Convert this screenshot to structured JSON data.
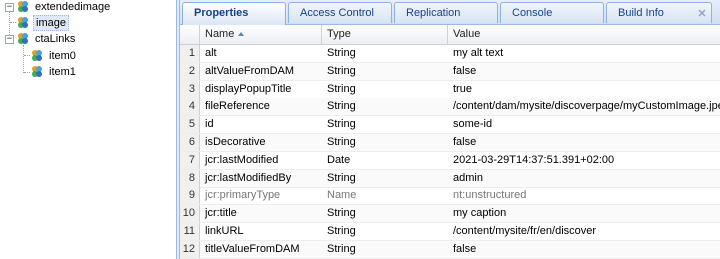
{
  "tree": {
    "nodes": [
      {
        "label": "extendedimage",
        "icon": "node-icon",
        "expanded": true,
        "level": 0,
        "selected": false
      },
      {
        "label": "image",
        "icon": "node-icon",
        "expanded": false,
        "level": 1,
        "selected": true
      },
      {
        "label": "ctaLinks",
        "icon": "node-icon",
        "expanded": true,
        "level": 1,
        "selected": false
      },
      {
        "label": "item0",
        "icon": "node-icon",
        "expanded": false,
        "level": 2,
        "selected": false
      },
      {
        "label": "item1",
        "icon": "node-icon",
        "expanded": false,
        "level": 2,
        "selected": false
      }
    ]
  },
  "tabs": [
    {
      "label": "Properties",
      "active": true
    },
    {
      "label": "Access Control",
      "active": false
    },
    {
      "label": "Replication",
      "active": false
    },
    {
      "label": "Console",
      "active": false
    },
    {
      "label": "Build Info",
      "active": false
    }
  ],
  "grid": {
    "columns": {
      "name": "Name",
      "type": "Type",
      "value": "Value"
    },
    "sort": "ascending",
    "rows": [
      {
        "num": "1",
        "name": "alt",
        "type": "String",
        "value": "my alt text",
        "protected": false
      },
      {
        "num": "2",
        "name": "altValueFromDAM",
        "type": "String",
        "value": "false",
        "protected": false
      },
      {
        "num": "3",
        "name": "displayPopupTitle",
        "type": "String",
        "value": "true",
        "protected": false
      },
      {
        "num": "4",
        "name": "fileReference",
        "type": "String",
        "value": "/content/dam/mysite/discoverpage/myCustomImage.jpeg",
        "protected": false
      },
      {
        "num": "5",
        "name": "id",
        "type": "String",
        "value": "some-id",
        "protected": false
      },
      {
        "num": "6",
        "name": "isDecorative",
        "type": "String",
        "value": "false",
        "protected": false
      },
      {
        "num": "7",
        "name": "jcr:lastModified",
        "type": "Date",
        "value": "2021-03-29T14:37:51.391+02:00",
        "protected": false
      },
      {
        "num": "8",
        "name": "jcr:lastModifiedBy",
        "type": "String",
        "value": "admin",
        "protected": false
      },
      {
        "num": "9",
        "name": "jcr:primaryType",
        "type": "Name",
        "value": "nt:unstructured",
        "protected": true
      },
      {
        "num": "10",
        "name": "jcr:title",
        "type": "String",
        "value": "my caption",
        "protected": false
      },
      {
        "num": "11",
        "name": "linkURL",
        "type": "String",
        "value": "/content/mysite/fr/en/discover",
        "protected": false
      },
      {
        "num": "12",
        "name": "titleValueFromDAM",
        "type": "String",
        "value": "false",
        "protected": false
      }
    ]
  },
  "colors": {
    "tab_text": "#15428b",
    "selection": "#dfe8f6",
    "panel_border": "#99bbe8",
    "protected_text": "#777777"
  }
}
